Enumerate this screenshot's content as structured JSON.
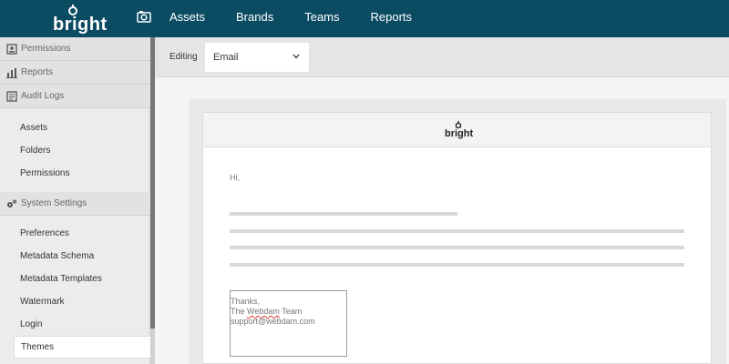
{
  "app": {
    "logo_text": "bright"
  },
  "nav": {
    "items": [
      "Assets",
      "Brands",
      "Teams",
      "Reports"
    ]
  },
  "sidebar": {
    "sections_top": [
      {
        "label": "Permissions",
        "icon": "id-card-icon"
      },
      {
        "label": "Reports",
        "icon": "bar-chart-icon"
      },
      {
        "label": "Audit Logs",
        "icon": "log-icon"
      }
    ],
    "group_items": [
      "Assets",
      "Folders",
      "Permissions"
    ],
    "system_section": {
      "label": "System Settings",
      "icon": "gears-icon"
    },
    "system_items": [
      "Preferences",
      "Metadata Schema",
      "Metadata Templates",
      "Watermark",
      "Login",
      "Themes"
    ],
    "active_item": "Themes"
  },
  "editbar": {
    "label": "Editing",
    "selected": "Email"
  },
  "email": {
    "logo_text": "bright",
    "greeting": "Hi,",
    "signature": {
      "line1": "Thanks,",
      "line2_a": "The ",
      "line2_b": "Webdam",
      "line2_c": " Team",
      "line3": "support@webdam.com"
    }
  },
  "colors": {
    "topbar": "#0b4c63",
    "active_accent": "#0b4c63"
  }
}
